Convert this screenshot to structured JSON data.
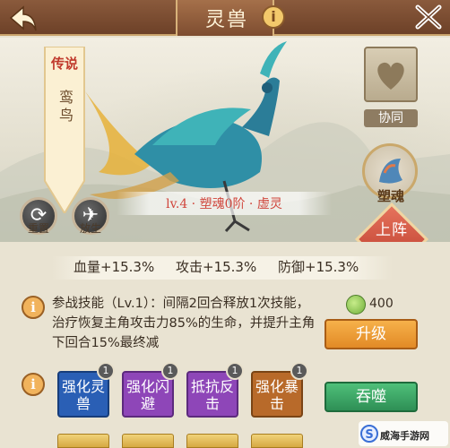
{
  "header": {
    "title": "灵兽",
    "back_icon": "back-arrow-icon",
    "info_label": "i",
    "close_icon": "close-x-icon"
  },
  "beast": {
    "rarity": "传说",
    "name": "鸾鸟",
    "level_text": "lv.4 · 塑魂0阶 · 虚灵"
  },
  "left_actions": [
    {
      "label": "重置",
      "icon": "refresh-icon"
    },
    {
      "label": "放生",
      "icon": "bird-release-icon"
    }
  ],
  "right_actions": {
    "coop_label": "协同",
    "soul_label": "塑魂",
    "deploy_label": "上阵"
  },
  "tab_star": "★",
  "stats": [
    {
      "label": "血量+15.3%"
    },
    {
      "label": "攻击+15.3%"
    },
    {
      "label": "防御+15.3%"
    }
  ],
  "skill": {
    "text": "参战技能（Lv.1）：间隔2回合释放1次技能，治疗恢复主角攻击力85%的生命，并提升主角下回合15%最终减"
  },
  "upgrade": {
    "cost": "400",
    "cost_icon": "green-fruit-icon",
    "button": "升级"
  },
  "enhancements": [
    {
      "label": "强化灵兽",
      "badge": "1",
      "color": "#2a5fb5"
    },
    {
      "label": "强化闪避",
      "badge": "1",
      "color": "#8e46b8"
    },
    {
      "label": "抵抗反击",
      "badge": "1",
      "color": "#8e46b8"
    },
    {
      "label": "强化暴击",
      "badge": "1",
      "color": "#b86a2a"
    }
  ],
  "devour_button": "吞噬",
  "watermark": "威海手游网"
}
